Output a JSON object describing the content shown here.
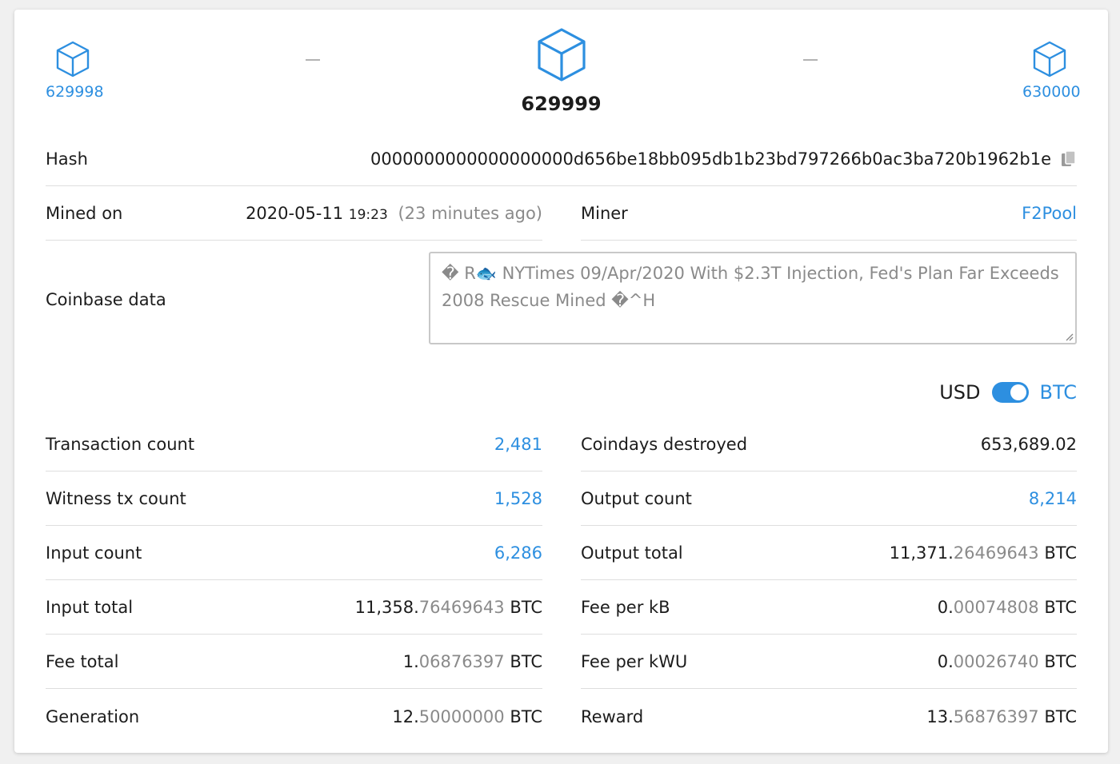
{
  "nav": {
    "prev_block": "629998",
    "current_block": "629999",
    "next_block": "630000"
  },
  "hash": {
    "label": "Hash",
    "value": "0000000000000000000d656be18bb095db1b23bd797266b0ac3ba720b1962b1e"
  },
  "mined_on": {
    "label": "Mined on",
    "date": "2020-05-11",
    "time": "19:23",
    "ago": "(23 minutes ago)"
  },
  "miner": {
    "label": "Miner",
    "value": "F2Pool"
  },
  "coinbase": {
    "label": "Coinbase data",
    "text": "�   R🐟 NYTimes 09/Apr/2020 With $2.3T Injection, Fed's Plan Far Exceeds 2008 Rescue   Mined   �^H"
  },
  "currency_toggle": {
    "left_label": "USD",
    "right_label": "BTC",
    "selected": "BTC"
  },
  "stats_left": [
    {
      "label": "Transaction count",
      "value": "2,481",
      "link": true
    },
    {
      "label": "Witness tx count",
      "value": "1,528",
      "link": true
    },
    {
      "label": "Input count",
      "value": "6,286",
      "link": true
    },
    {
      "label": "Input total",
      "int": "11,358.",
      "frac": "76469643",
      "unit": "BTC"
    },
    {
      "label": "Fee total",
      "int": "1.",
      "frac": "06876397",
      "unit": "BTC"
    },
    {
      "label": "Generation",
      "int": "12.",
      "frac": "50000000",
      "unit": "BTC"
    }
  ],
  "stats_right": [
    {
      "label": "Coindays destroyed",
      "value": "653,689.02",
      "link": false
    },
    {
      "label": "Output count",
      "value": "8,214",
      "link": true
    },
    {
      "label": "Output total",
      "int": "11,371.",
      "frac": "26469643",
      "unit": "BTC"
    },
    {
      "label": "Fee per kB",
      "int": "0.",
      "frac": "00074808",
      "unit": "BTC"
    },
    {
      "label": "Fee per kWU",
      "int": "0.",
      "frac": "00026740",
      "unit": "BTC"
    },
    {
      "label": "Reward",
      "int": "13.",
      "frac": "56876397",
      "unit": "BTC"
    }
  ],
  "colors": {
    "accent": "#2d8fe0",
    "text": "#1c1c1c",
    "muted": "#8a8a8a",
    "divider": "#dedede"
  }
}
